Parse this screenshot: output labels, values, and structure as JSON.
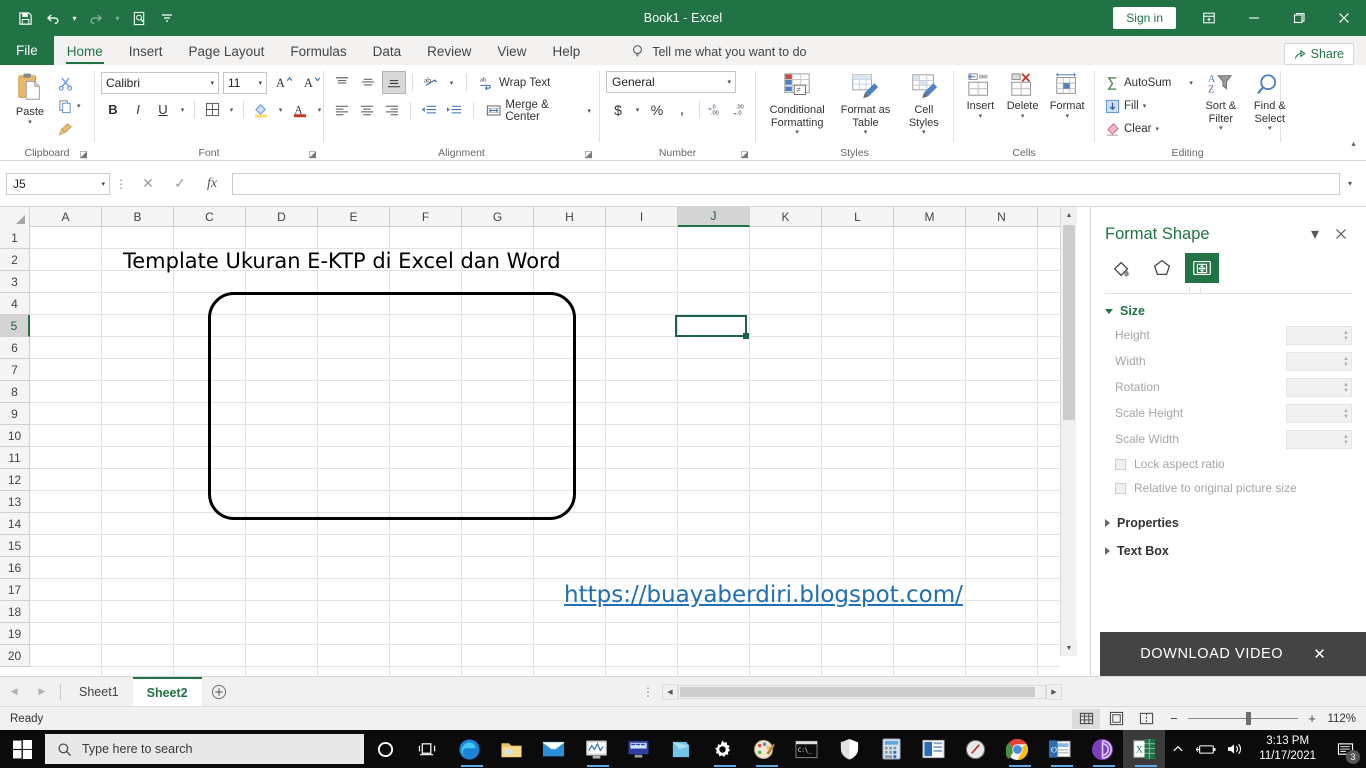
{
  "titlebar": {
    "title": "Book1 - Excel",
    "signin_label": "Sign in",
    "qat": [
      {
        "name": "save-icon",
        "label": "Save"
      },
      {
        "name": "undo-icon",
        "label": "Undo"
      },
      {
        "name": "redo-icon",
        "label": "Redo"
      },
      {
        "name": "print-preview-icon",
        "label": "Print Preview and Print"
      },
      {
        "name": "customize-qat-icon",
        "label": "Customize Quick Access Toolbar"
      }
    ],
    "window_controls": {
      "ribbon_display": "Ribbon Display Options",
      "minimize": "Minimize",
      "restore": "Restore Down",
      "close": "Close"
    }
  },
  "tabs": [
    {
      "label": "File",
      "active": false
    },
    {
      "label": "Home",
      "active": true
    },
    {
      "label": "Insert",
      "active": false
    },
    {
      "label": "Page Layout",
      "active": false
    },
    {
      "label": "Formulas",
      "active": false
    },
    {
      "label": "Data",
      "active": false
    },
    {
      "label": "Review",
      "active": false
    },
    {
      "label": "View",
      "active": false
    },
    {
      "label": "Help",
      "active": false
    }
  ],
  "tellme": {
    "placeholder": "Tell me what you want to do"
  },
  "share": {
    "label": "Share"
  },
  "ribbon": {
    "clipboard": {
      "label": "Clipboard",
      "paste": "Paste",
      "cut": "Cut",
      "copy": "Copy",
      "format_painter": "Format Painter"
    },
    "font": {
      "label": "Font",
      "font_name": "Calibri",
      "font_size": "11",
      "increase_size": "Increase Font Size",
      "decrease_size": "Decrease Font Size",
      "bold": "B",
      "italic": "I",
      "underline": "U",
      "borders": "Borders",
      "fill_color": "Fill Color",
      "font_color": "Font Color"
    },
    "alignment": {
      "label": "Alignment",
      "top_align": "Top Align",
      "middle_align": "Middle Align",
      "bottom_align": "Bottom Align",
      "orientation": "Orientation",
      "wrap_text": "Wrap Text",
      "align_left": "Align Left",
      "center": "Center",
      "align_right": "Align Right",
      "decrease_indent": "Decrease Indent",
      "increase_indent": "Increase Indent",
      "merge_center": "Merge & Center"
    },
    "number": {
      "label": "Number",
      "format": "General",
      "accounting": "Accounting Number Format",
      "percent": "Percent Style",
      "comma": "Comma Style",
      "increase_decimal": "Increase Decimal",
      "decrease_decimal": "Decrease Decimal"
    },
    "styles": {
      "label": "Styles",
      "conditional_formatting": "Conditional Formatting",
      "format_as_table": "Format as Table",
      "cell_styles": "Cell Styles"
    },
    "cells": {
      "label": "Cells",
      "insert": "Insert",
      "delete": "Delete",
      "format": "Format"
    },
    "editing": {
      "label": "Editing",
      "autosum": "AutoSum",
      "fill": "Fill",
      "clear": "Clear",
      "sort_filter": "Sort & Filter",
      "find_select": "Find & Select"
    }
  },
  "formula_bar": {
    "name_box": "J5",
    "cancel": "Cancel",
    "enter": "Enter",
    "insert_function": "fx",
    "formula_value": "",
    "expand": "Expand Formula Bar"
  },
  "grid": {
    "columns": [
      "A",
      "B",
      "C",
      "D",
      "E",
      "F",
      "G",
      "H",
      "I",
      "J",
      "K",
      "L",
      "M",
      "N"
    ],
    "active_column": "J",
    "rows": [
      "1",
      "2",
      "3",
      "4",
      "5",
      "6",
      "7",
      "8",
      "9",
      "10",
      "11",
      "12",
      "13",
      "14",
      "15",
      "16",
      "17",
      "18",
      "19",
      "20"
    ],
    "active_row": "5",
    "selected_cell": "J5",
    "content": {
      "sheet_title": "Template Ukuran E-KTP di Excel dan Word",
      "link_text": "https://buayaberdiri.blogspot.com/",
      "shape_name": "rounded-rectangle-ktp-template"
    }
  },
  "format_shape_pane": {
    "title": "Format Shape",
    "pane_options": "Pane Options",
    "close": "Close",
    "tabs": [
      {
        "name": "fill-line-icon",
        "label": "Fill & Line",
        "selected": false
      },
      {
        "name": "effects-icon",
        "label": "Effects",
        "selected": false
      },
      {
        "name": "size-properties-icon",
        "label": "Size & Properties",
        "selected": true
      }
    ],
    "sections": [
      {
        "label": "Size",
        "expanded": true
      },
      {
        "label": "Properties",
        "expanded": false
      },
      {
        "label": "Text Box",
        "expanded": false
      }
    ],
    "size_fields": [
      {
        "label": "Height",
        "underline": "He",
        "rest": "ight",
        "value": ""
      },
      {
        "label": "Width",
        "underline": "Wid",
        "rest": "th",
        "value": ""
      },
      {
        "label": "Rotation",
        "underline": "Rota",
        "rest": "tion",
        "value": ""
      },
      {
        "label": "Scale Height",
        "underline": "Scale H",
        "rest": "eight",
        "value": ""
      },
      {
        "label": "Scale Width",
        "underline": "Scale W",
        "rest": "idth",
        "value": ""
      }
    ],
    "checkboxes": [
      {
        "label": "Lock aspect ratio",
        "checked": false
      },
      {
        "label": "Relative to original picture size",
        "checked": false
      }
    ]
  },
  "download_overlay": {
    "label": "DOWNLOAD VIDEO",
    "close": "Close"
  },
  "sheet_tabs": {
    "prev": "Previous Sheet",
    "next": "Next Sheet",
    "tabs": [
      {
        "label": "Sheet1",
        "active": false
      },
      {
        "label": "Sheet2",
        "active": true
      }
    ],
    "add": "New sheet",
    "more": "Sheet tab options"
  },
  "status_bar": {
    "status": "Ready",
    "view_modes": [
      {
        "name": "normal-view-icon",
        "label": "Normal",
        "selected": true
      },
      {
        "name": "page-layout-view-icon",
        "label": "Page Layout",
        "selected": false
      },
      {
        "name": "page-break-preview-icon",
        "label": "Page Break Preview",
        "selected": false
      }
    ],
    "zoom_out": "−",
    "zoom_in": "+",
    "zoom_level": "112%"
  },
  "taskbar": {
    "start": "Start",
    "search_placeholder": "Type here to search",
    "cortana": "Cortana",
    "task_view": "Task View",
    "apps": [
      {
        "name": "edge-icon",
        "label": "Microsoft Edge",
        "running": true
      },
      {
        "name": "file-explorer-icon",
        "label": "File Explorer",
        "running": false
      },
      {
        "name": "mail-icon",
        "label": "Mail",
        "running": false
      },
      {
        "name": "performance-monitor-icon",
        "label": "Performance Monitor",
        "running": true
      },
      {
        "name": "remote-desktop-icon",
        "label": "Remote Desktop",
        "running": false
      },
      {
        "name": "notes-icon",
        "label": "Sticky Notes",
        "running": false
      },
      {
        "name": "settings-icon",
        "label": "Settings",
        "running": true
      },
      {
        "name": "paint-icon",
        "label": "Paint",
        "running": true
      },
      {
        "name": "command-prompt-icon",
        "label": "Command Prompt",
        "running": false
      },
      {
        "name": "windows-defender-icon",
        "label": "Windows Security",
        "running": false
      },
      {
        "name": "calculator-icon",
        "label": "Calculator",
        "running": false
      },
      {
        "name": "powerpoint-icon",
        "label": "PowerPoint",
        "running": false
      },
      {
        "name": "snipping-tool-icon",
        "label": "Snipping Tool",
        "running": false
      },
      {
        "name": "chrome-icon",
        "label": "Google Chrome",
        "running": true
      },
      {
        "name": "outlook-icon",
        "label": "Outlook",
        "running": true
      },
      {
        "name": "tor-browser-icon",
        "label": "Tor Browser",
        "running": true
      },
      {
        "name": "excel-icon",
        "label": "Excel",
        "running": true,
        "active": true
      }
    ],
    "tray": {
      "show_hidden": "Show hidden icons",
      "battery": "Battery",
      "volume": "Volume"
    },
    "clock": {
      "time": "3:13 PM",
      "date": "11/17/2021"
    },
    "notifications": {
      "label": "Notifications",
      "count": "3"
    }
  }
}
